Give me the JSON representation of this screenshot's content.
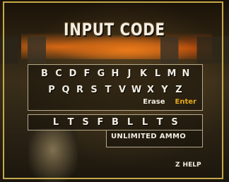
{
  "title": "INPUT CODE",
  "keyboard": {
    "row1": [
      "B",
      "C",
      "D",
      "F",
      "G",
      "H",
      "J",
      "K",
      "L",
      "M",
      "N"
    ],
    "row2": [
      "P",
      "Q",
      "R",
      "S",
      "T",
      "V",
      "W",
      "X",
      "Y",
      "Z"
    ],
    "erase_label": "Erase",
    "enter_label": "Enter"
  },
  "code_entry": [
    "L",
    "T",
    "S",
    "F",
    "B",
    "L",
    "L",
    "T",
    "S"
  ],
  "result": "UNLIMITED AMMO",
  "help": {
    "button": "Z",
    "label": "HELP"
  },
  "colors": {
    "frame": "#c5a94a",
    "enter": "#e6a81c",
    "text": "#f1ede2"
  }
}
